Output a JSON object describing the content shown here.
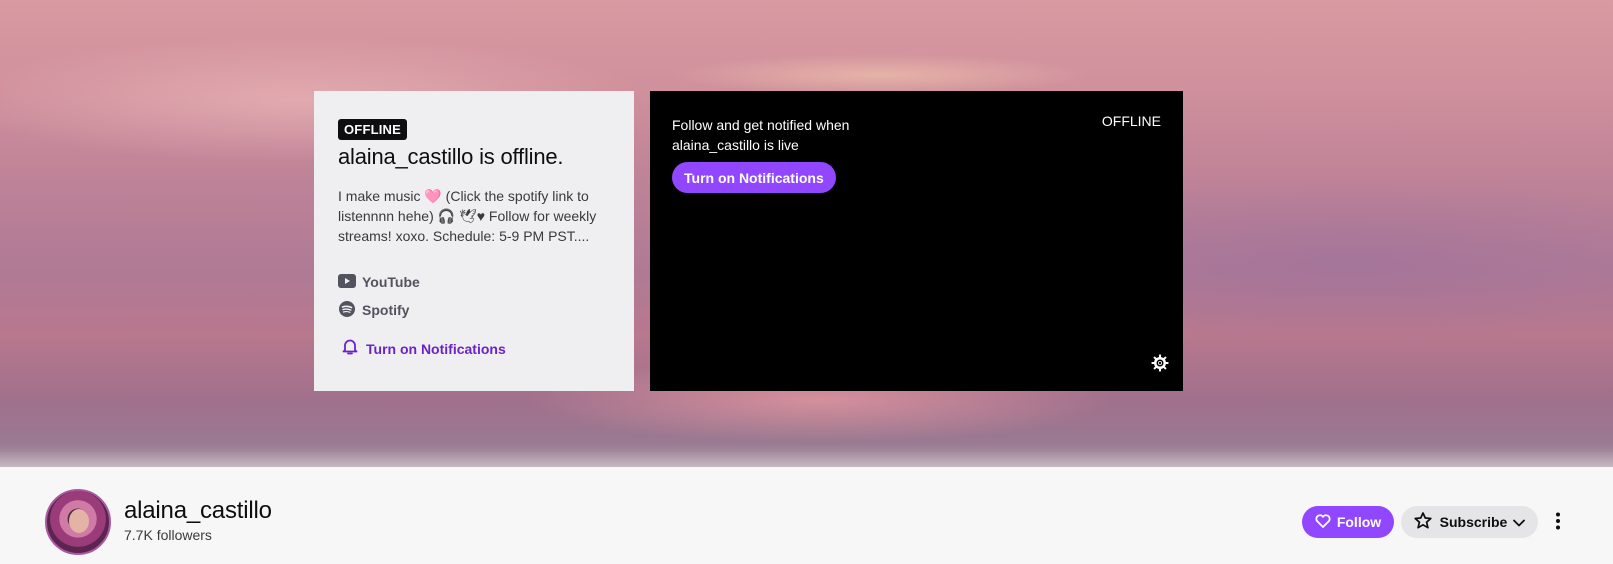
{
  "colors": {
    "accent": "#9147ff",
    "link_purple": "#6b23c9",
    "player_bg": "#000000",
    "card_bg": "#efeff1"
  },
  "offline_card": {
    "badge": "OFFLINE",
    "title": "alaina_castillo is offline.",
    "description": "I make music 🩷 (Click the spotify link to listennnn hehe) 🎧 🕊♥ Follow for weekly streams! xoxo. Schedule: 5-9 PM PST....",
    "links": [
      {
        "label": "YouTube",
        "icon": "youtube-icon"
      },
      {
        "label": "Spotify",
        "icon": "spotify-icon"
      }
    ],
    "notifications_label": "Turn on Notifications"
  },
  "player": {
    "message": "Follow and get notified when alaina_castillo is live",
    "button_label": "Turn on Notifications",
    "status": "OFFLINE",
    "settings_icon": "gear-icon"
  },
  "channel": {
    "name": "alaina_castillo",
    "followers": "7.7K followers",
    "follow_label": "Follow",
    "subscribe_label": "Subscribe",
    "more_icon": "more-vertical-icon"
  }
}
